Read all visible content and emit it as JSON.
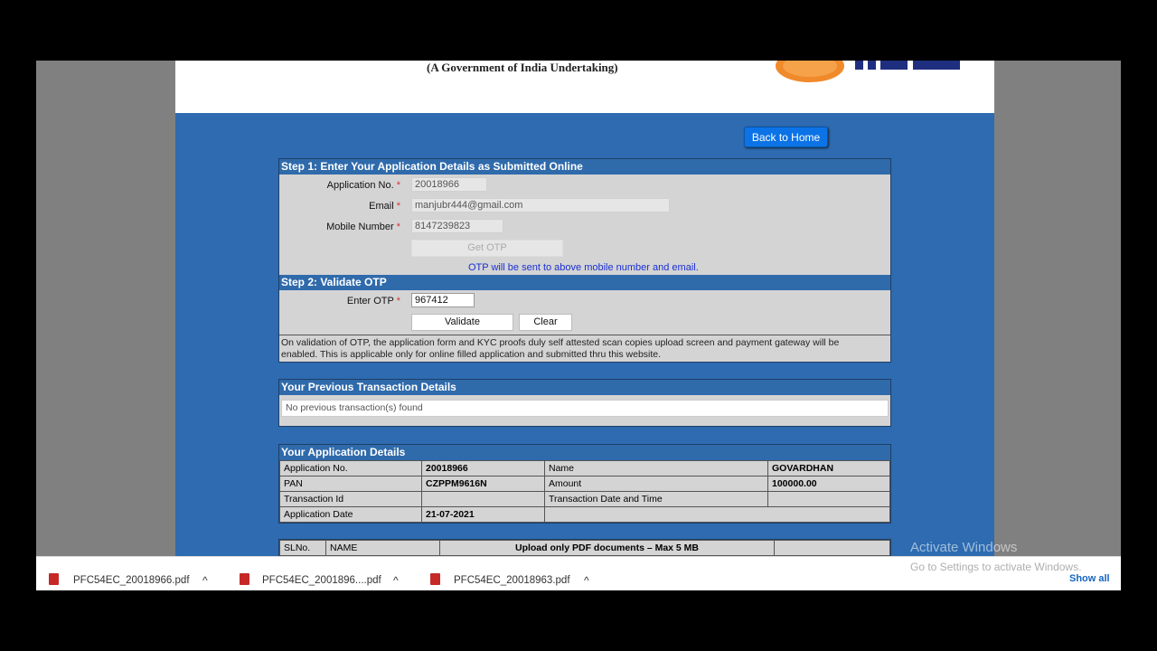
{
  "header": {
    "gov_text": "(A Government of India Undertaking)",
    "back_button": "Back to Home"
  },
  "step1": {
    "title": "Step 1: Enter Your Application Details as Submitted Online",
    "app_no_label": "Application No.",
    "app_no_value": "20018966",
    "email_label": "Email",
    "email_value": "manjubr444@gmail.com",
    "mobile_label": "Mobile Number",
    "mobile_value": "8147239823",
    "req_mark": "*",
    "get_otp": "Get OTP",
    "otp_note": "OTP will be sent to above mobile number and email."
  },
  "step2": {
    "title": "Step 2: Validate OTP",
    "otp_label": "Enter OTP",
    "otp_value": "967412",
    "validate": "Validate",
    "clear": "Clear",
    "note": "On validation of OTP, the application form and KYC proofs duly self attested scan copies upload screen and payment gateway will be enabled. This is applicable only for online filled application and submitted thru this website."
  },
  "transactions": {
    "title": "Your Previous Transaction Details",
    "empty": "No previous transaction(s) found"
  },
  "application": {
    "title": "Your Application Details",
    "rows": [
      [
        "Application No.",
        "20018966",
        "Name",
        "GOVARDHAN"
      ],
      [
        "PAN",
        "CZPPM9616N",
        "Amount",
        "100000.00"
      ],
      [
        "Transaction Id",
        "",
        "Transaction Date and Time",
        ""
      ],
      [
        "Application Date",
        "21-07-2021",
        "",
        ""
      ]
    ]
  },
  "upload": {
    "sl": "SLNo.",
    "name": "NAME",
    "note": "Upload only PDF documents – Max 5 MB"
  },
  "downloads": {
    "items": [
      "PFC54EC_20018966.pdf",
      "PFC54EC_2001896....pdf",
      "PFC54EC_20018963.pdf"
    ],
    "show_all": "Show all"
  },
  "watermark": {
    "line1": "Activate Windows",
    "line2": "Go to Settings to activate Windows."
  },
  "colors": {
    "page_blue": "#2e6bb0",
    "panel_head": "#2f6aab",
    "button_blue": "#0b73e6"
  }
}
